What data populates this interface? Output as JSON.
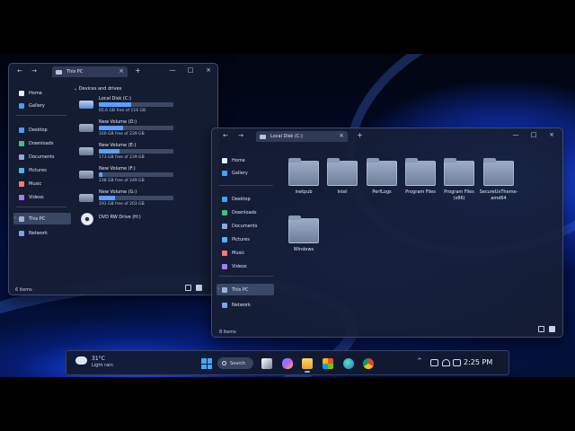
{
  "colors": {
    "accent": "#5aa0ff",
    "window_bg": "#161e34",
    "wallpaper_blue": "#2f63ff"
  },
  "window_left": {
    "tab_title": "This PC",
    "sidebar": [
      {
        "label": "Home",
        "icon": "home-icon"
      },
      {
        "label": "Gallery",
        "icon": "gallery-icon"
      },
      {
        "label": "Desktop",
        "icon": "desktop-icon"
      },
      {
        "label": "Downloads",
        "icon": "downloads-icon"
      },
      {
        "label": "Documents",
        "icon": "documents-icon"
      },
      {
        "label": "Pictures",
        "icon": "pictures-icon"
      },
      {
        "label": "Music",
        "icon": "music-icon"
      },
      {
        "label": "Videos",
        "icon": "videos-icon"
      },
      {
        "label": "This PC",
        "icon": "computer-icon",
        "active": true
      },
      {
        "label": "Network",
        "icon": "network-icon"
      }
    ],
    "section_heading": "Devices and drives",
    "drives": [
      {
        "name": "Local Disk (C:)",
        "free": "65.6 GB free of 116 GB",
        "used_fraction": 0.43
      },
      {
        "name": "New Volume (D:)",
        "free": "160 GB free of 239 GB",
        "used_fraction": 0.33
      },
      {
        "name": "New Volume (E:)",
        "free": "173 GB free of 239 GB",
        "used_fraction": 0.28
      },
      {
        "name": "New Volume (F:)",
        "free": "238 GB free of 249 GB",
        "used_fraction": 0.05
      },
      {
        "name": "New Volume (G:)",
        "free": "191 GB free of 203 GB",
        "used_fraction": 0.22
      }
    ],
    "dvd_drive": "DVD RW Drive (H:)",
    "status": "6 items"
  },
  "window_right": {
    "tab_title": "Local Disk (C:)",
    "sidebar": [
      {
        "label": "Home",
        "icon": "home-icon"
      },
      {
        "label": "Gallery",
        "icon": "gallery-icon"
      },
      {
        "label": "Desktop",
        "icon": "desktop-icon"
      },
      {
        "label": "Downloads",
        "icon": "downloads-icon"
      },
      {
        "label": "Documents",
        "icon": "documents-icon"
      },
      {
        "label": "Pictures",
        "icon": "pictures-icon"
      },
      {
        "label": "Music",
        "icon": "music-icon"
      },
      {
        "label": "Videos",
        "icon": "videos-icon"
      },
      {
        "label": "This PC",
        "icon": "computer-icon",
        "active": true
      },
      {
        "label": "Network",
        "icon": "network-icon"
      }
    ],
    "folders": [
      {
        "label": "inetpub"
      },
      {
        "label": "Intel"
      },
      {
        "label": "PerfLogs"
      },
      {
        "label": "Program Files"
      },
      {
        "label": "Program Files\n(x86)"
      },
      {
        "label": "SecureUxTheme-\namd64"
      },
      {
        "label": "Windows"
      }
    ],
    "status": "8 items"
  },
  "taskbar": {
    "weather_temp": "31°C",
    "weather_desc": "Light rain",
    "search_label": "Search",
    "clock": "2:25 PM",
    "tray_chevron": "^",
    "apps": [
      "file-explorer-icon",
      "copilot-icon",
      "folder-icon",
      "store-icon",
      "edge-icon",
      "chrome-icon"
    ]
  },
  "glyphs": {
    "back": "←",
    "forward": "→",
    "close": "×",
    "new_tab": "+",
    "minimize": "—",
    "maximize": "□",
    "chevron": "›"
  }
}
